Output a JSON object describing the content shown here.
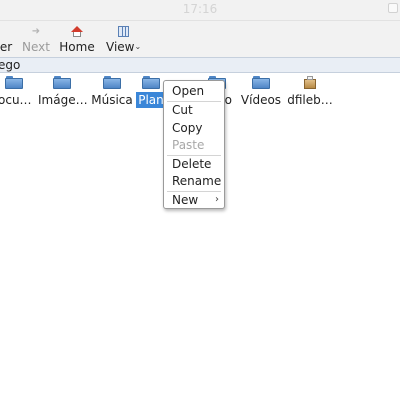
{
  "window": {
    "clock": "17:16"
  },
  "toolbar": {
    "partial_label": "er",
    "next_label": "Next",
    "next_icon": "arrow-right-icon",
    "home_label": "Home",
    "home_icon": "home-icon",
    "view_label": "View",
    "view_icon": "grid-view-icon"
  },
  "address": {
    "path": "ego"
  },
  "files": [
    {
      "name": "ocu…",
      "icon": "folder-icon"
    },
    {
      "name": "Imáge…",
      "icon": "folder-icon"
    },
    {
      "name": "Música",
      "icon": "folder-icon"
    },
    {
      "name": "Plan",
      "icon": "folder-icon",
      "selected": true
    },
    {
      "name": "o",
      "icon": "folder-icon"
    },
    {
      "name": "Vídeos",
      "icon": "folder-icon"
    },
    {
      "name": "dfileb…",
      "icon": "package-icon"
    }
  ],
  "context_menu": {
    "items": [
      {
        "label": "Open"
      },
      {
        "label": "Cut"
      },
      {
        "label": "Copy"
      },
      {
        "label": "Paste",
        "disabled": true
      },
      {
        "label": "Delete"
      },
      {
        "label": "Rename"
      },
      {
        "label": "New",
        "submenu_arrow": "›"
      }
    ]
  },
  "colors": {
    "selection": "#3a86d8",
    "home_roof": "#d23c2d",
    "folder": "#4f86c6"
  }
}
